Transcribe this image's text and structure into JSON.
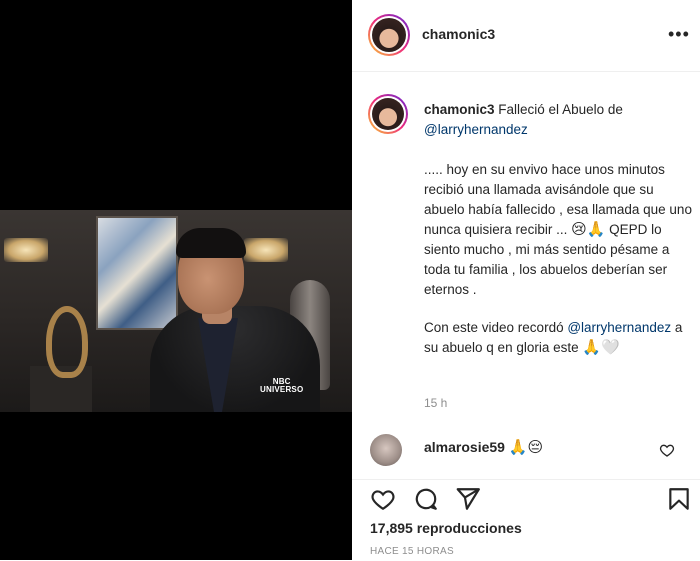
{
  "post": {
    "username": "chamonic3",
    "more_icon": "more-options-icon"
  },
  "video": {
    "watermark_line1": "NBC",
    "watermark_line2": "UNIVERSO"
  },
  "caption": {
    "username": "chamonic3",
    "title_text": " Falleció el Abuelo de ",
    "mention1": "@larryhernandez",
    "paragraph1_a": "..... hoy en su envivo hace unos minutos recibió una llamada avisándole que su abuelo había fallecido , esa llamada que uno nunca quisiera recibir ... ",
    "paragraph1_emojis": "😢🙏",
    "paragraph1_b": " QEPD lo siento mucho , mi más sentido pésame a toda tu familia , los abuelos deberían ser eternos .",
    "paragraph2_a": "Con este video recordó ",
    "mention2": "@larryhernandez",
    "paragraph2_b": " a su abuelo q en gloria este ",
    "paragraph2_emojis": "🙏🤍",
    "time": "15 h"
  },
  "comment": {
    "username": "almarosie59",
    "emojis": "🙏😔"
  },
  "actions": {
    "views": "17,895 reproducciones",
    "timestamp": "HACE 15 HORAS"
  },
  "colors": {
    "text": "#262626",
    "secondary": "#8e8e8e",
    "mention": "#00376b",
    "border": "#efefef",
    "media_bg": "#000000"
  }
}
